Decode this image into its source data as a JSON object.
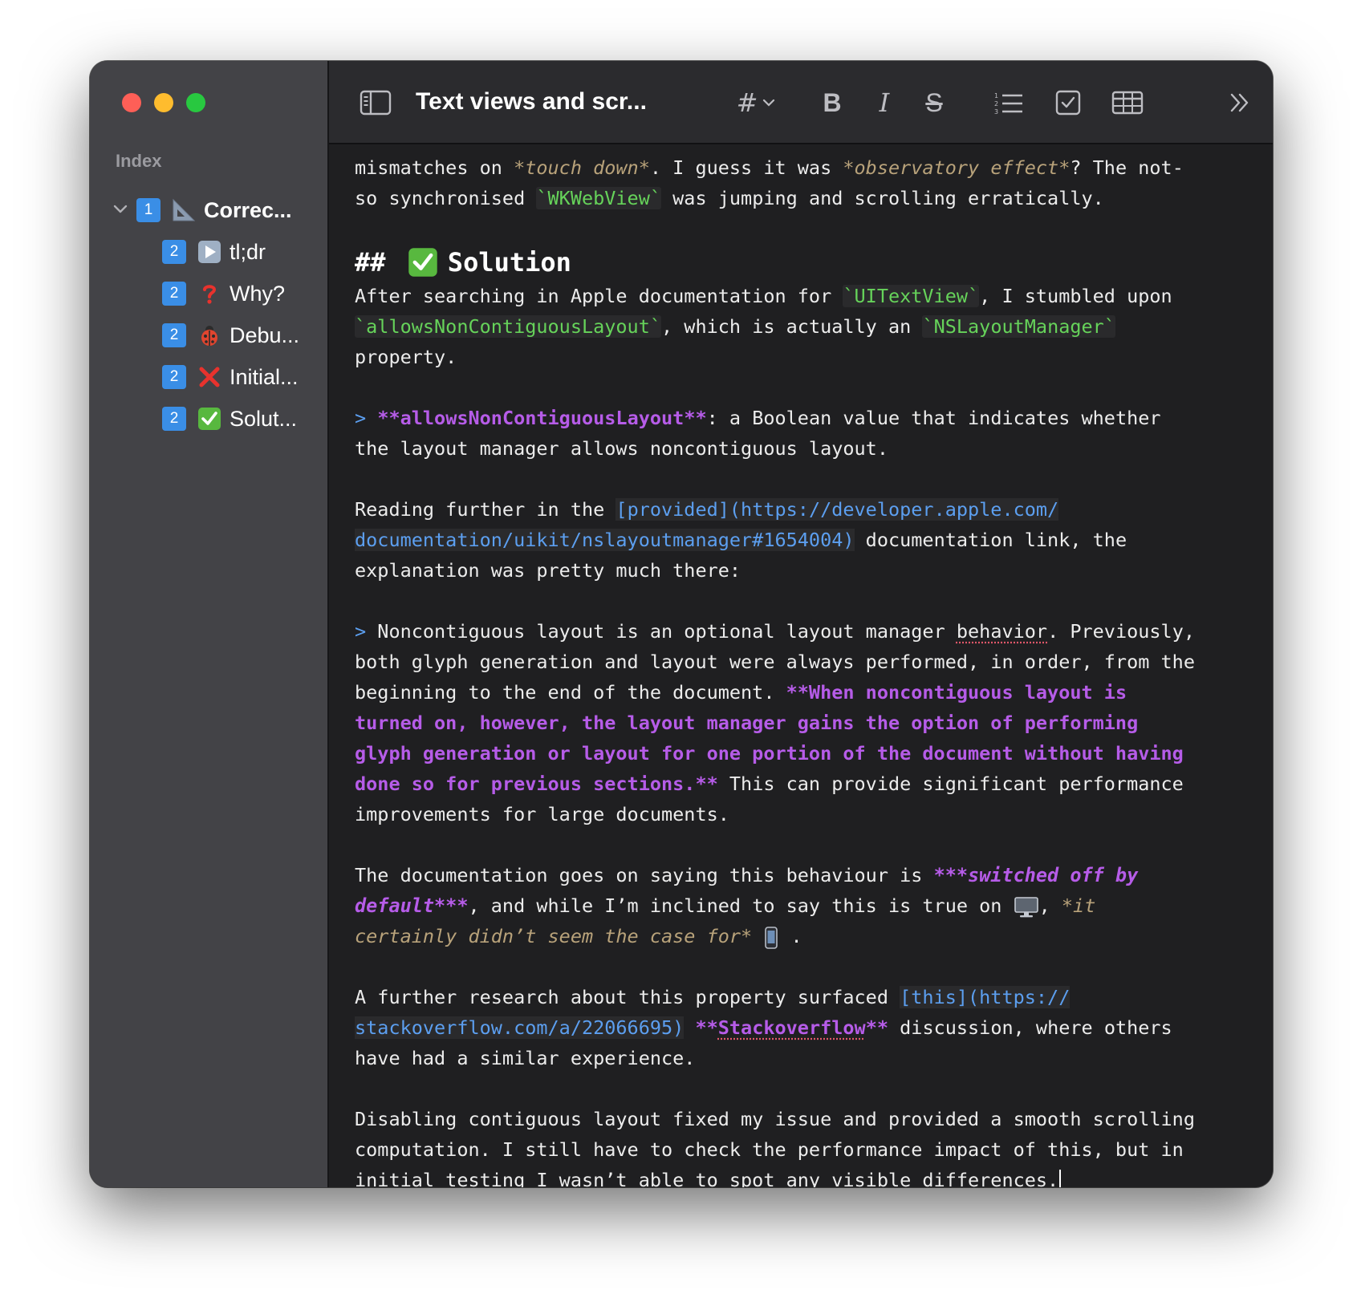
{
  "window": {
    "title": "Text views and scr...",
    "traffic_lights": {
      "close": "#fe5f57",
      "minimize": "#febc2e",
      "zoom": "#28c840"
    }
  },
  "sidebar": {
    "index_label": "Index",
    "outline": [
      {
        "level": "1",
        "icon": "triangle-ruler-icon",
        "label": "Correc..."
      },
      {
        "level": "2",
        "icon": "play-button-icon",
        "label": "tl;dr"
      },
      {
        "level": "2",
        "icon": "question-mark-icon",
        "label": "Why?"
      },
      {
        "level": "2",
        "icon": "ladybug-icon",
        "label": "Debu..."
      },
      {
        "level": "2",
        "icon": "cross-mark-icon",
        "label": "Initial..."
      },
      {
        "level": "2",
        "icon": "check-mark-icon",
        "label": "Solut..."
      }
    ]
  },
  "toolbar": {
    "heading_glyph": "#",
    "bold_glyph": "B",
    "italic_glyph": "I",
    "strike_glyph": "S",
    "icons": [
      "sidebar-toggle-icon",
      "heading-icon",
      "bold-icon",
      "italic-icon",
      "strikethrough-icon",
      "list-icon",
      "checkbox-icon",
      "table-icon",
      "overflow-chevron-icon"
    ]
  },
  "editor": {
    "p0_l1a": "mismatches on ",
    "p0_l1b": "*touch down*",
    "p0_l1c": ". I guess it was ",
    "p0_l1d": "*observatory effect*",
    "p0_l1e": "? The not-",
    "p0_l2a": "so synchronised ",
    "p0_l2b": "`WKWebView`",
    "p0_l2c": " was jumping and scrolling erratically.",
    "h2_marker": "##",
    "h2_text": "Solution",
    "p1_l1a": "After searching in Apple documentation for ",
    "p1_l1b": "`UITextView`",
    "p1_l1c": ", I stumbled upon",
    "p1_l2a": "`allowsNonContiguousLayout`",
    "p1_l2b": ", which is actually an ",
    "p1_l2c": "`NSLayoutManager`",
    "p1_l3": "property.",
    "q1_marker": ">",
    "q1_l1a": "**allowsNonContiguousLayout**",
    "q1_l1b": ": a Boolean value that indicates whether",
    "q1_l2": "the layout manager allows noncontiguous layout.",
    "p2_l1a": "Reading further in the ",
    "p2_l1b": "[provided](https://developer.apple.com/",
    "p2_l2a": "documentation/uikit/nslayoutmanager#1654004)",
    "p2_l2b": " documentation link, the",
    "p2_l3": "explanation was pretty much there:",
    "q2_marker": ">",
    "q2_l1a": " Noncontiguous layout is an optional layout manager ",
    "q2_l1b": "behavior",
    "q2_l1c": ". Previously,",
    "q2_l2": "both glyph generation and layout were always performed, in order, from the",
    "q2_l3a": "beginning to the end of the document. ",
    "q2_l3b": "**When noncontiguous layout is",
    "q2_l4": "turned on, however, the layout manager gains the option of performing",
    "q2_l5": "glyph generation or layout for one portion of the document without having",
    "q2_l6a": "done so for previous sections.**",
    "q2_l6b": " This can provide significant performance",
    "q2_l7": "improvements for large documents.",
    "p3_l1a": "The documentation goes on saying this behaviour is ",
    "p3_l1b": "***switched off by",
    "p3_l2a": "default***",
    "p3_l2b": ", and while I’m inclined to say this is true on ",
    "p3_l2c": ", ",
    "p3_l2d": "*it",
    "p3_l3a": "certainly didn’t seem the case for*",
    "p3_l3b": " .",
    "p4_l1a": "A further research about this property surfaced ",
    "p4_l1b": "[this](https://",
    "p4_l2a": "stackoverflow.com/a/22066695)",
    "p4_l2b": " **",
    "p4_l2c": "Stackoverflow",
    "p4_l2d": "**",
    "p4_l2e": " discussion, where others",
    "p4_l3": "have had a similar experience.",
    "p5_l1": "Disabling contiguous layout fixed my issue and provided a smooth scrolling",
    "p5_l2": "computation. I still have to check the performance impact of this, but in",
    "p5_l3": "initial testing I wasn’t able to spot any visible differences."
  },
  "colors": {
    "code": "#66d35a",
    "italic": "#b8a27a",
    "bold_emphasis": "#b65ce8",
    "link": "#5c9ff0",
    "sidebar_bg": "#434347",
    "editor_bg": "#1f1f21"
  }
}
